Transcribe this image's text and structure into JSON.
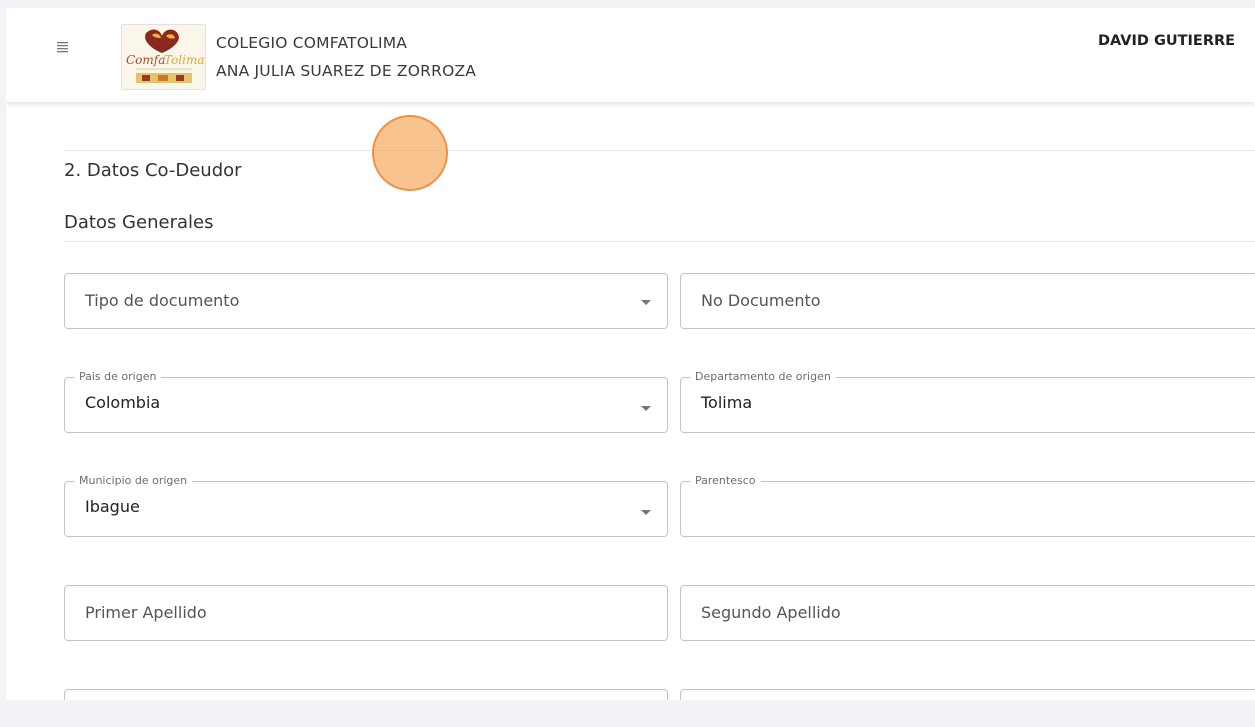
{
  "header": {
    "menu_icon": "hamburger-menu-icon",
    "logo_text": "ComfaTolima",
    "school_line1": "COLEGIO COMFATOLIMA",
    "school_line2": "ANA JULIA SUAREZ DE ZORROZA",
    "user_name": "DAVID GUTIERRE"
  },
  "form": {
    "section_title": "2. Datos Co-Deudor",
    "subsection_title": "Datos Generales",
    "tipo_documento": {
      "placeholder": "Tipo de documento"
    },
    "no_documento": {
      "placeholder": "No Documento"
    },
    "pais_origen": {
      "label": "Pais de origen",
      "value": "Colombia"
    },
    "departamento_origen": {
      "label": "Departamento de origen",
      "value": "Tolima"
    },
    "municipio_origen": {
      "label": "Municipio de origen",
      "value": "Ibague"
    },
    "parentesco": {
      "label": "Parentesco",
      "value": ""
    },
    "primer_apellido": {
      "placeholder": "Primer Apellido"
    },
    "segundo_apellido": {
      "placeholder": "Segundo Apellido"
    }
  },
  "colors": {
    "background": "#f1f3f7",
    "field_border": "#c4c4c4",
    "click_indicator": "#f59e4b"
  }
}
